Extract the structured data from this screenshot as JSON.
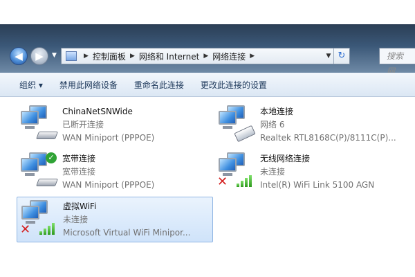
{
  "window": {
    "breadcrumb": [
      "控制面板",
      "网络和 Internet",
      "网络连接"
    ],
    "search_placeholder": "搜索 网...",
    "nav": {
      "back_icon": "arrow-left",
      "forward_icon": "arrow-right",
      "refresh_icon": "refresh-arrows"
    }
  },
  "toolbar": {
    "organize_label": "组织 ▾",
    "disable_label": "禁用此网络设备",
    "rename_label": "重命名此连接",
    "change_settings_label": "更改此连接的设置"
  },
  "connections": [
    {
      "name": "ChinaNetSNWide",
      "status": "已断开连接",
      "device": "WAN Miniport (PPPOE)",
      "icon": "broadband-disconnected-icon"
    },
    {
      "name": "本地连接",
      "status": "网络  6",
      "device": "Realtek RTL8168C(P)/8111C(P)...",
      "icon": "ethernet-connected-icon"
    },
    {
      "name": "宽带连接",
      "status": "宽带连接",
      "device": "WAN Miniport (PPPOE)",
      "icon": "broadband-connected-icon"
    },
    {
      "name": "无线网络连接",
      "status": "未连接",
      "device": "Intel(R) WiFi Link 5100 AGN",
      "icon": "wireless-disconnected-icon"
    },
    {
      "name": "虚拟WiFi",
      "status": "未连接",
      "device": "Microsoft Virtual WiFi Minipor...",
      "icon": "virtual-wifi-disconnected-icon",
      "selected": true
    }
  ],
  "colors": {
    "title_bar": "#3b5878",
    "toolbar_text": "#1e395b",
    "selection_bg": "#cfe3fa",
    "error_red": "#d42020",
    "signal_green": "#2f9a1e"
  }
}
